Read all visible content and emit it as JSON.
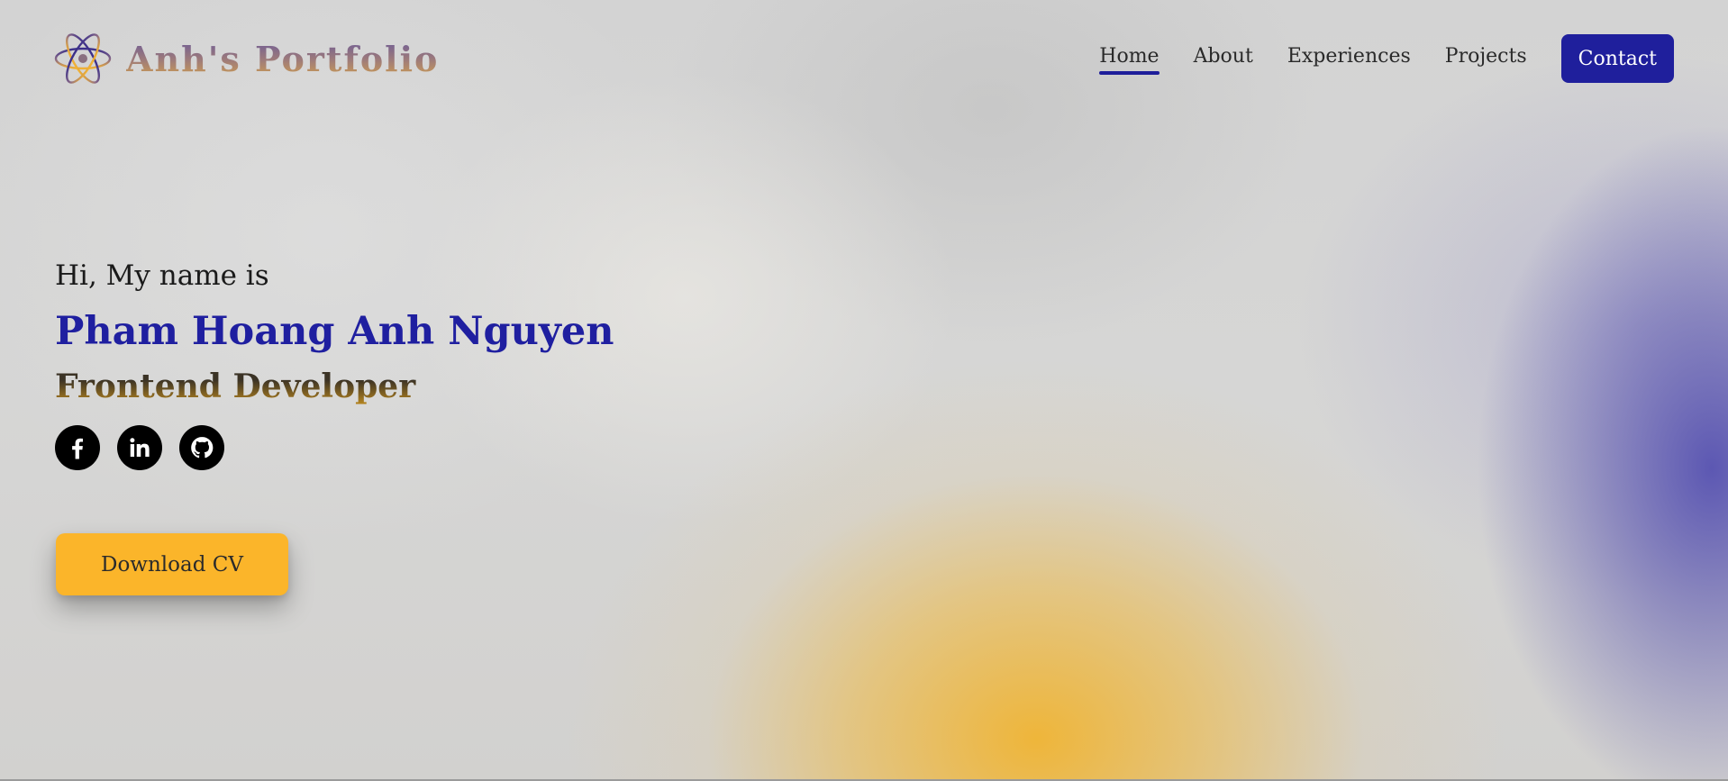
{
  "header": {
    "logo_text": "Anh's Portfolio",
    "logo_icon": "atom-icon",
    "nav": [
      {
        "label": "Home",
        "active": true
      },
      {
        "label": "About",
        "active": false
      },
      {
        "label": "Experiences",
        "active": false
      },
      {
        "label": "Projects",
        "active": false
      }
    ],
    "contact_label": "Contact"
  },
  "hero": {
    "greeting": "Hi, My name is",
    "name": "Pham Hoang Anh Nguyen",
    "role": "Frontend Developer",
    "socials": [
      {
        "icon": "facebook-icon"
      },
      {
        "icon": "linkedin-icon"
      },
      {
        "icon": "github-icon"
      }
    ],
    "cv_label": "Download CV"
  },
  "colors": {
    "primary": "#1f1f9c",
    "accent": "#fbb52a"
  }
}
